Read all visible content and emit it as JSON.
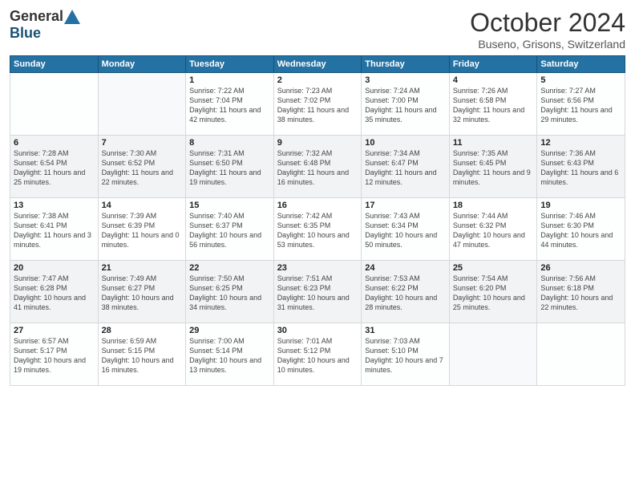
{
  "header": {
    "logo_general": "General",
    "logo_blue": "Blue",
    "title": "October 2024",
    "location": "Buseno, Grisons, Switzerland"
  },
  "days_of_week": [
    "Sunday",
    "Monday",
    "Tuesday",
    "Wednesday",
    "Thursday",
    "Friday",
    "Saturday"
  ],
  "weeks": [
    [
      {
        "day": "",
        "info": ""
      },
      {
        "day": "",
        "info": ""
      },
      {
        "day": "1",
        "info": "Sunrise: 7:22 AM\nSunset: 7:04 PM\nDaylight: 11 hours and 42 minutes."
      },
      {
        "day": "2",
        "info": "Sunrise: 7:23 AM\nSunset: 7:02 PM\nDaylight: 11 hours and 38 minutes."
      },
      {
        "day": "3",
        "info": "Sunrise: 7:24 AM\nSunset: 7:00 PM\nDaylight: 11 hours and 35 minutes."
      },
      {
        "day": "4",
        "info": "Sunrise: 7:26 AM\nSunset: 6:58 PM\nDaylight: 11 hours and 32 minutes."
      },
      {
        "day": "5",
        "info": "Sunrise: 7:27 AM\nSunset: 6:56 PM\nDaylight: 11 hours and 29 minutes."
      }
    ],
    [
      {
        "day": "6",
        "info": "Sunrise: 7:28 AM\nSunset: 6:54 PM\nDaylight: 11 hours and 25 minutes."
      },
      {
        "day": "7",
        "info": "Sunrise: 7:30 AM\nSunset: 6:52 PM\nDaylight: 11 hours and 22 minutes."
      },
      {
        "day": "8",
        "info": "Sunrise: 7:31 AM\nSunset: 6:50 PM\nDaylight: 11 hours and 19 minutes."
      },
      {
        "day": "9",
        "info": "Sunrise: 7:32 AM\nSunset: 6:48 PM\nDaylight: 11 hours and 16 minutes."
      },
      {
        "day": "10",
        "info": "Sunrise: 7:34 AM\nSunset: 6:47 PM\nDaylight: 11 hours and 12 minutes."
      },
      {
        "day": "11",
        "info": "Sunrise: 7:35 AM\nSunset: 6:45 PM\nDaylight: 11 hours and 9 minutes."
      },
      {
        "day": "12",
        "info": "Sunrise: 7:36 AM\nSunset: 6:43 PM\nDaylight: 11 hours and 6 minutes."
      }
    ],
    [
      {
        "day": "13",
        "info": "Sunrise: 7:38 AM\nSunset: 6:41 PM\nDaylight: 11 hours and 3 minutes."
      },
      {
        "day": "14",
        "info": "Sunrise: 7:39 AM\nSunset: 6:39 PM\nDaylight: 11 hours and 0 minutes."
      },
      {
        "day": "15",
        "info": "Sunrise: 7:40 AM\nSunset: 6:37 PM\nDaylight: 10 hours and 56 minutes."
      },
      {
        "day": "16",
        "info": "Sunrise: 7:42 AM\nSunset: 6:35 PM\nDaylight: 10 hours and 53 minutes."
      },
      {
        "day": "17",
        "info": "Sunrise: 7:43 AM\nSunset: 6:34 PM\nDaylight: 10 hours and 50 minutes."
      },
      {
        "day": "18",
        "info": "Sunrise: 7:44 AM\nSunset: 6:32 PM\nDaylight: 10 hours and 47 minutes."
      },
      {
        "day": "19",
        "info": "Sunrise: 7:46 AM\nSunset: 6:30 PM\nDaylight: 10 hours and 44 minutes."
      }
    ],
    [
      {
        "day": "20",
        "info": "Sunrise: 7:47 AM\nSunset: 6:28 PM\nDaylight: 10 hours and 41 minutes."
      },
      {
        "day": "21",
        "info": "Sunrise: 7:49 AM\nSunset: 6:27 PM\nDaylight: 10 hours and 38 minutes."
      },
      {
        "day": "22",
        "info": "Sunrise: 7:50 AM\nSunset: 6:25 PM\nDaylight: 10 hours and 34 minutes."
      },
      {
        "day": "23",
        "info": "Sunrise: 7:51 AM\nSunset: 6:23 PM\nDaylight: 10 hours and 31 minutes."
      },
      {
        "day": "24",
        "info": "Sunrise: 7:53 AM\nSunset: 6:22 PM\nDaylight: 10 hours and 28 minutes."
      },
      {
        "day": "25",
        "info": "Sunrise: 7:54 AM\nSunset: 6:20 PM\nDaylight: 10 hours and 25 minutes."
      },
      {
        "day": "26",
        "info": "Sunrise: 7:56 AM\nSunset: 6:18 PM\nDaylight: 10 hours and 22 minutes."
      }
    ],
    [
      {
        "day": "27",
        "info": "Sunrise: 6:57 AM\nSunset: 5:17 PM\nDaylight: 10 hours and 19 minutes."
      },
      {
        "day": "28",
        "info": "Sunrise: 6:59 AM\nSunset: 5:15 PM\nDaylight: 10 hours and 16 minutes."
      },
      {
        "day": "29",
        "info": "Sunrise: 7:00 AM\nSunset: 5:14 PM\nDaylight: 10 hours and 13 minutes."
      },
      {
        "day": "30",
        "info": "Sunrise: 7:01 AM\nSunset: 5:12 PM\nDaylight: 10 hours and 10 minutes."
      },
      {
        "day": "31",
        "info": "Sunrise: 7:03 AM\nSunset: 5:10 PM\nDaylight: 10 hours and 7 minutes."
      },
      {
        "day": "",
        "info": ""
      },
      {
        "day": "",
        "info": ""
      }
    ]
  ]
}
